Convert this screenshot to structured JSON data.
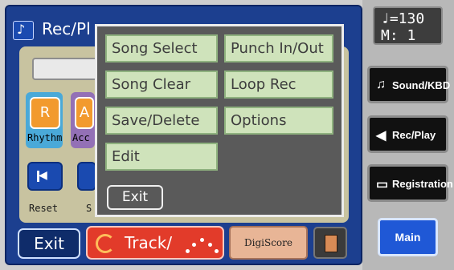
{
  "header": {
    "title": "Rec/Pl"
  },
  "parts": {
    "rhythm": {
      "cap": "R",
      "label": "Rhythm"
    },
    "accomp": {
      "cap": "A",
      "label": "Acc"
    }
  },
  "transport": {
    "reset_label": "Reset",
    "second_label": "S"
  },
  "bottom_bar": {
    "exit_label": "Exit",
    "track_label": "Track/",
    "digiscore_label": "DigiScore"
  },
  "menu": {
    "items": [
      {
        "label": "Song Select"
      },
      {
        "label": "Punch In/Out"
      },
      {
        "label": "Song Clear"
      },
      {
        "label": "Loop Rec"
      },
      {
        "label": "Save/Delete"
      },
      {
        "label": "Options"
      },
      {
        "label": "Edit"
      }
    ],
    "exit_label": "Exit"
  },
  "sidebar": {
    "tempo_line1": "♩=130",
    "tempo_line2": "M:  1",
    "buttons": [
      {
        "label": "Sound/KBD",
        "icon": "music-notes-icon"
      },
      {
        "label": "Rec/Play",
        "icon": "speaker-icon"
      },
      {
        "label": "Registration",
        "icon": "book-icon"
      }
    ],
    "main_label": "Main"
  },
  "colors": {
    "panel_blue": "#1c3f8f",
    "menu_item": "#cfe3bb",
    "track_red": "#e23b2a",
    "main_blue": "#1f58d6"
  }
}
